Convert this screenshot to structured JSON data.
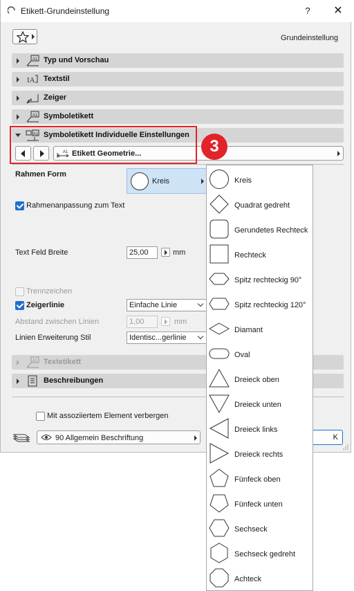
{
  "window": {
    "title": "Etikett-Grundeinstellung",
    "help_label": "?",
    "close_label": "✕"
  },
  "header": {
    "favorites_icon": "star-icon",
    "preset_label": "Grundeinstellung"
  },
  "panels": [
    {
      "label": "Typ und Vorschau",
      "icon": "type-preview-icon"
    },
    {
      "label": "Textstil",
      "icon": "text-style-icon"
    },
    {
      "label": "Zeiger",
      "icon": "pointer-icon"
    },
    {
      "label": "Symboletikett",
      "icon": "symbol-label-icon"
    },
    {
      "label": "Symboletikett Individuelle Einstellungen",
      "icon": "symbol-label-custom-icon",
      "expanded": true
    }
  ],
  "subpanel": {
    "page_label": "Etikett Geometrie..."
  },
  "callout_badge": "3",
  "form": {
    "frame_shape_label": "Rahmen Form",
    "frame_shape_value": "Kreis",
    "frame_fit_label": "Rahmenanpassung zum Text",
    "frame_fit_checked": true,
    "text_field_width_label": "Text Feld Breite",
    "text_field_width_value": "25,00",
    "text_field_width_unit": "mm",
    "separator_label": "Trennzeichen",
    "separator_checked": false,
    "leader_line_label": "Zeigerlinie",
    "leader_line_checked": true,
    "leader_line_value": "Einfache Linie",
    "line_spacing_label": "Abstand zwischen Linien",
    "line_spacing_value": "1,00",
    "line_spacing_unit": "mm",
    "line_extension_label": "Linien Erweiterung Stil",
    "line_extension_value": "Identisc...gerlinie"
  },
  "lower_panels": [
    {
      "label": "Textetikett",
      "icon": "text-label-icon",
      "disabled": true
    },
    {
      "label": "Beschreibungen",
      "icon": "description-icon",
      "disabled": false
    }
  ],
  "footer": {
    "hide_with_element_label": "Mit assoziiertem Element verbergen",
    "hide_with_element_checked": false,
    "layer_icon": "layer-icon",
    "layer_value": "90 Allgemein Beschriftung",
    "ok_label": "K"
  },
  "shape_menu": {
    "items": [
      {
        "label": "Kreis",
        "shape": "circle"
      },
      {
        "label": "Quadrat gedreht",
        "shape": "rotated-square"
      },
      {
        "label": "Gerundetes Rechteck",
        "shape": "rounded-rectangle"
      },
      {
        "label": "Rechteck",
        "shape": "rectangle"
      },
      {
        "label": "Spitz rechteckig 90°",
        "shape": "pointed-rect-90"
      },
      {
        "label": "Spitz rechteckig 120°",
        "shape": "pointed-rect-120"
      },
      {
        "label": "Diamant",
        "shape": "diamond"
      },
      {
        "label": "Oval",
        "shape": "oval"
      },
      {
        "label": "Dreieck oben",
        "shape": "triangle-up"
      },
      {
        "label": "Dreieck unten",
        "shape": "triangle-down"
      },
      {
        "label": "Dreieck links",
        "shape": "triangle-left"
      },
      {
        "label": "Dreieck rechts",
        "shape": "triangle-right"
      },
      {
        "label": "Fünfeck oben",
        "shape": "pentagon-up"
      },
      {
        "label": "Fünfeck unten",
        "shape": "pentagon-down"
      },
      {
        "label": "Sechseck",
        "shape": "hexagon"
      },
      {
        "label": "Sechseck gedreht",
        "shape": "hexagon-rotated"
      },
      {
        "label": "Achteck",
        "shape": "octagon"
      }
    ]
  }
}
